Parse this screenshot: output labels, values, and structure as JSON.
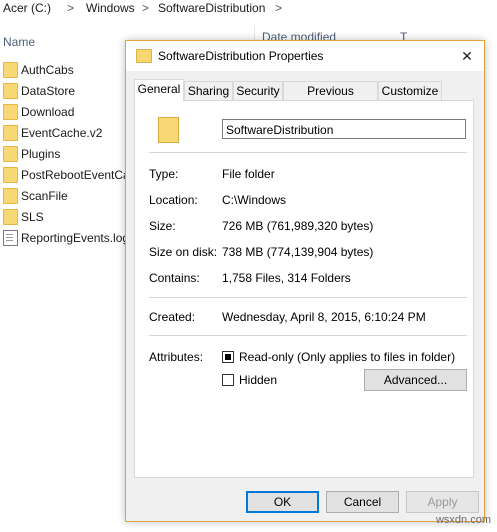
{
  "breadcrumb": {
    "items": [
      "Acer (C:)",
      "Windows",
      "SoftwareDistribution"
    ],
    "separator": ">"
  },
  "explorer": {
    "column_name": "Name",
    "column_2_partial": "Date modified",
    "column_3_partial": "T",
    "items": [
      {
        "name": "AuthCabs",
        "icon": "folder-icon"
      },
      {
        "name": "DataStore",
        "icon": "folder-icon"
      },
      {
        "name": "Download",
        "icon": "folder-icon"
      },
      {
        "name": "EventCache.v2",
        "icon": "folder-icon"
      },
      {
        "name": "Plugins",
        "icon": "folder-icon"
      },
      {
        "name": "PostRebootEventCache",
        "icon": "folder-icon"
      },
      {
        "name": "ScanFile",
        "icon": "folder-icon"
      },
      {
        "name": "SLS",
        "icon": "folder-icon"
      },
      {
        "name": "ReportingEvents.log",
        "icon": "document-icon"
      }
    ]
  },
  "dialog": {
    "title": "SoftwareDistribution Properties",
    "close_glyph": "✕",
    "tabs": [
      "General",
      "Sharing",
      "Security",
      "Previous Versions",
      "Customize"
    ],
    "active_tab": "General",
    "folder_name": "SoftwareDistribution",
    "labels": {
      "type": "Type:",
      "location": "Location:",
      "size": "Size:",
      "size_on_disk": "Size on disk:",
      "contains": "Contains:",
      "created": "Created:",
      "attributes": "Attributes:"
    },
    "values": {
      "type": "File folder",
      "location": "C:\\Windows",
      "size": "726 MB (761,989,320 bytes)",
      "size_on_disk": "738 MB (774,139,904 bytes)",
      "contains": "1,758 Files, 314 Folders",
      "created": "Wednesday, April 8, 2015, 6:10:24 PM"
    },
    "attributes": {
      "readonly_label": "Read-only (Only applies to files in folder)",
      "readonly_state": "indeterminate",
      "hidden_label": "Hidden",
      "hidden_state": "unchecked",
      "advanced_label": "Advanced..."
    },
    "buttons": {
      "ok": "OK",
      "cancel": "Cancel",
      "apply": "Apply"
    },
    "accent_color": "#0078d7",
    "border_color": "#e3a33c"
  },
  "watermark": "wsxdn.com"
}
